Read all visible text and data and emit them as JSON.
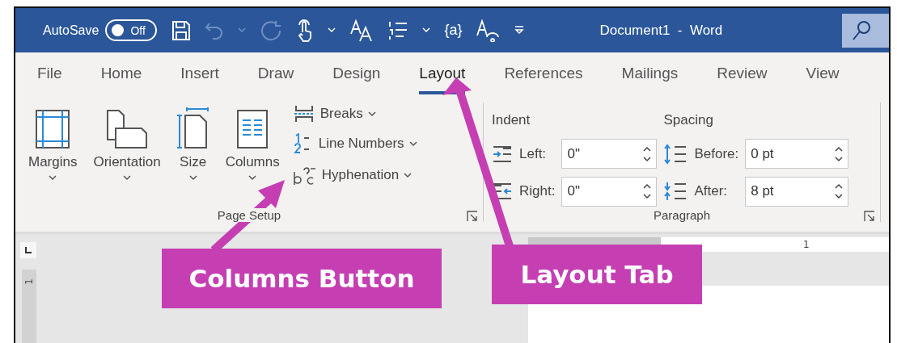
{
  "title_bar": {
    "autosave": {
      "label": "AutoSave",
      "state": "Off",
      "on": false
    },
    "quick_access": [
      {
        "kind": "save",
        "disabled": false
      },
      {
        "kind": "undo",
        "disabled": true
      },
      {
        "kind": "dropdown",
        "disabled": true
      },
      {
        "kind": "redo",
        "disabled": true
      },
      {
        "kind": "touch",
        "disabled": false
      },
      {
        "kind": "dropdown",
        "disabled": false
      },
      {
        "kind": "font-size",
        "disabled": false
      },
      {
        "kind": "list",
        "disabled": false
      },
      {
        "kind": "dropdown",
        "disabled": false
      },
      {
        "kind": "text",
        "label": "{a}",
        "disabled": false
      },
      {
        "kind": "accessibility",
        "disabled": false
      },
      {
        "kind": "customize",
        "disabled": false
      }
    ],
    "document_title": "Document1  -  Word"
  },
  "tabs": [
    {
      "label": "File",
      "selected": false
    },
    {
      "label": "Home",
      "selected": false
    },
    {
      "label": "Insert",
      "selected": false
    },
    {
      "label": "Draw",
      "selected": false
    },
    {
      "label": "Design",
      "selected": false
    },
    {
      "label": "Layout",
      "selected": true
    },
    {
      "label": "References",
      "selected": false
    },
    {
      "label": "Mailings",
      "selected": false
    },
    {
      "label": "Review",
      "selected": false
    },
    {
      "label": "View",
      "selected": false
    }
  ],
  "page_setup": {
    "label": "Page Setup",
    "large_buttons": [
      {
        "kind": "margins",
        "label": "Margins"
      },
      {
        "kind": "orientation",
        "label": "Orientation"
      },
      {
        "kind": "size",
        "label": "Size"
      },
      {
        "kind": "columns",
        "label": "Columns"
      }
    ],
    "small_buttons": [
      {
        "kind": "breaks",
        "label": "Breaks"
      },
      {
        "kind": "line-numbers",
        "label": "Line Numbers"
      },
      {
        "kind": "hyphenation",
        "label": "Hyphenation"
      }
    ]
  },
  "paragraph": {
    "label": "Paragraph",
    "indent_heading": "Indent",
    "spacing_heading": "Spacing",
    "indent": [
      {
        "kind": "left",
        "label": "Left:",
        "value": "0\""
      },
      {
        "kind": "right",
        "label": "Right:",
        "value": "0\""
      }
    ],
    "spacing": [
      {
        "kind": "before",
        "label": "Before:",
        "value": "0 pt"
      },
      {
        "kind": "after",
        "label": "After:",
        "value": "8 pt"
      }
    ]
  },
  "ruler": {
    "horizontal_label": "1",
    "vertical_label": "1"
  },
  "callouts": [
    {
      "kind": "columns",
      "text": "Columns Button"
    },
    {
      "kind": "layout",
      "text": "Layout Tab"
    }
  ]
}
